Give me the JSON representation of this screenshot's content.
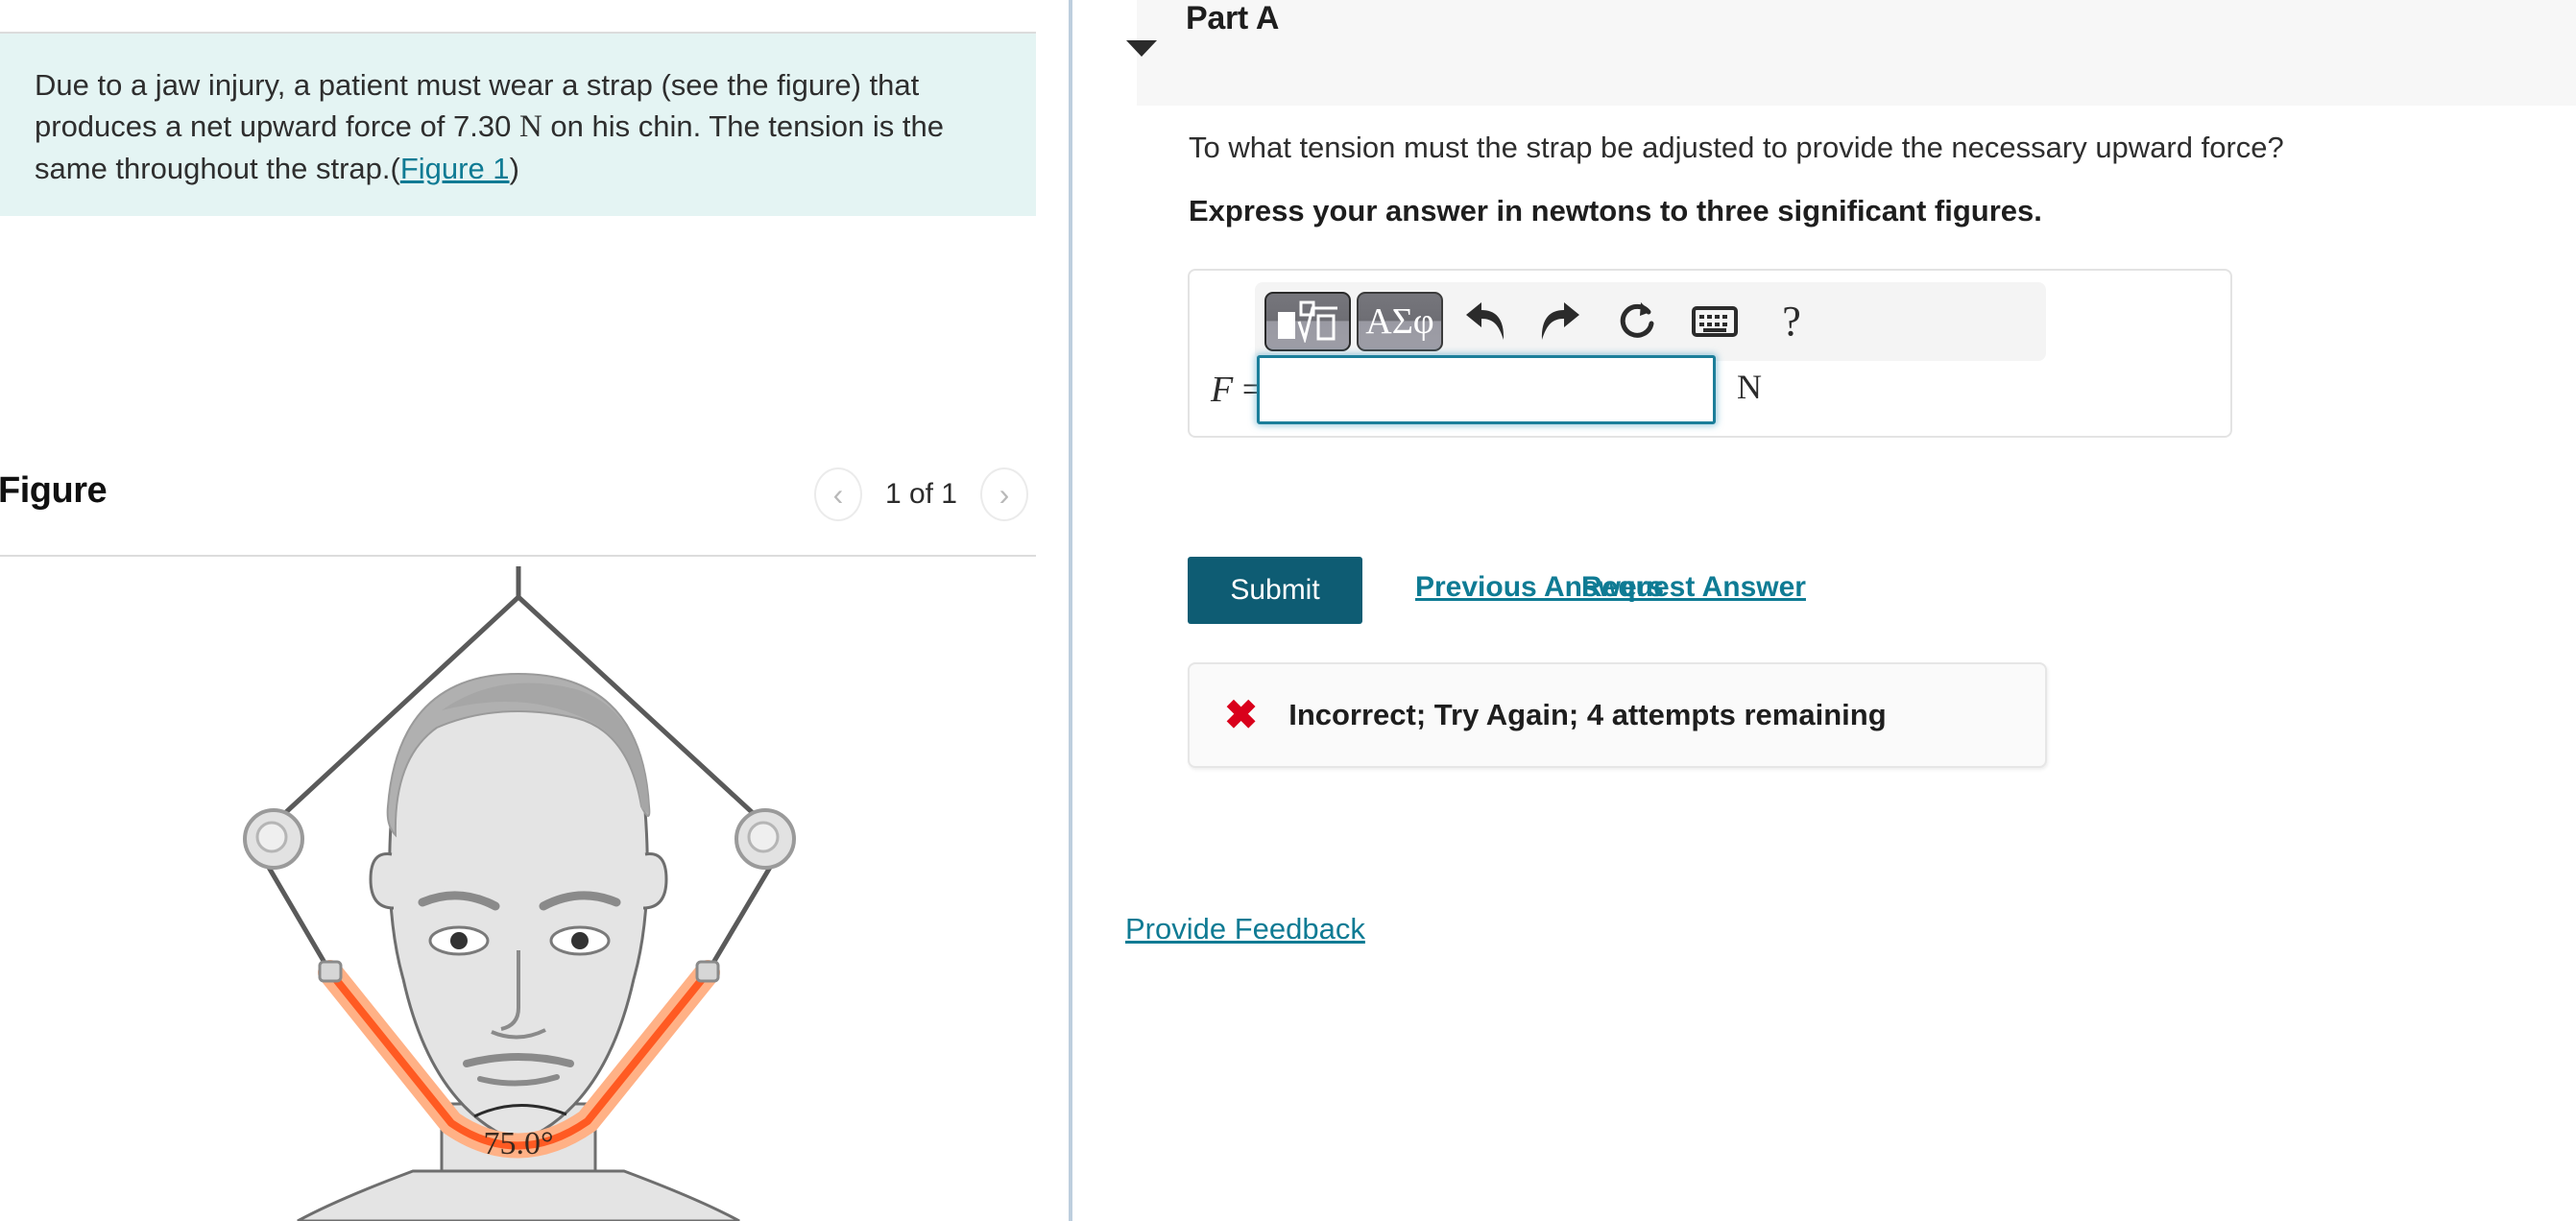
{
  "problem": {
    "text_before_unit": "Due to a jaw injury, a patient must wear a strap (see the figure) that produces a net upward force of 7.30 ",
    "unit_symbol": "N",
    "text_after_unit": " on his chin. The tension is the same throughout the strap.(",
    "figure_link_label": "Figure 1",
    "text_close_paren": ")"
  },
  "figure_panel": {
    "title": "Figure",
    "prev_icon": "chevron-left-icon",
    "next_icon": "chevron-right-icon",
    "counter": "1 of 1",
    "angle_label": "75.0°"
  },
  "part": {
    "caret_icon": "caret-down-icon",
    "title": "Part A",
    "question": "To what tension must the strap be adjusted to provide the necessary upward force?",
    "instruction": "Express your answer in newtons to three significant figures."
  },
  "answer": {
    "toolbar": {
      "math_template_button": "math-template-icon",
      "greek_button_label": "ΑΣφ",
      "undo_icon": "undo-arrow-icon",
      "redo_icon": "redo-arrow-icon",
      "reset_icon": "refresh-circle-icon",
      "keyboard_icon": "keyboard-icon",
      "help_icon": "?"
    },
    "variable_label": "F",
    "equals_sign": "=",
    "value": "",
    "placeholder": "",
    "unit": "N"
  },
  "actions": {
    "submit_label": "Submit",
    "previous_answers_label": "Previous Answers",
    "request_answer_label": "Request Answer"
  },
  "feedback": {
    "status_icon": "✖",
    "message": "Incorrect; Try Again; 4 attempts remaining"
  },
  "footer": {
    "provide_feedback_label": "Provide Feedback"
  },
  "colors": {
    "accent_teal": "#0f7b94",
    "submit_teal": "#0e5c73",
    "problem_bg": "#e4f4f3",
    "panel_gray": "#f7f7f7",
    "error_red": "#d9001b",
    "strap_orange": "#ff4d1a",
    "divider_blue": "#bdcede"
  }
}
